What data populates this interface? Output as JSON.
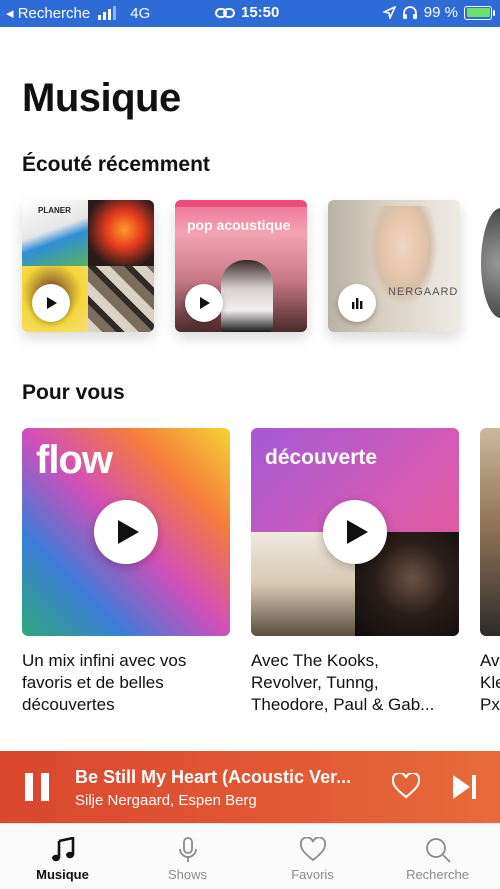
{
  "status_bar": {
    "carrier": "◂ Recherche",
    "network": "4G",
    "time": "15:50",
    "battery": "99 %"
  },
  "page_title": "Musique",
  "recent": {
    "title": "Écouté récemment",
    "items": [
      {
        "cover_text": "PLANER",
        "icon": "play-icon"
      },
      {
        "cover_text": "pop acoustique",
        "icon": "play-icon"
      },
      {
        "cover_text": "NERGAARD",
        "icon": "equalizer-icon"
      }
    ]
  },
  "for_you": {
    "title": "Pour vous",
    "cards": [
      {
        "label": "flow",
        "description_lines": [
          "Un mix infini avec vos",
          "favoris et de belles",
          "découvertes"
        ]
      },
      {
        "label": "découverte",
        "description_lines": [
          "Avec The Kooks,",
          "Revolver, Tunng,",
          "Theodore, Paul & Gab..."
        ]
      },
      {
        "label": "",
        "description_lines": [
          "Av",
          "Kle",
          "Px"
        ]
      }
    ]
  },
  "player": {
    "title": "Be Still My Heart (Acoustic Ver...",
    "artist": "Silje Nergaard, Espen Berg",
    "accent_color": "#e0502f"
  },
  "tabs": [
    {
      "label": "Musique",
      "icon": "music-note-icon",
      "active": true
    },
    {
      "label": "Shows",
      "icon": "microphone-icon",
      "active": false
    },
    {
      "label": "Favoris",
      "icon": "heart-icon",
      "active": false
    },
    {
      "label": "Recherche",
      "icon": "search-icon",
      "active": false
    }
  ]
}
